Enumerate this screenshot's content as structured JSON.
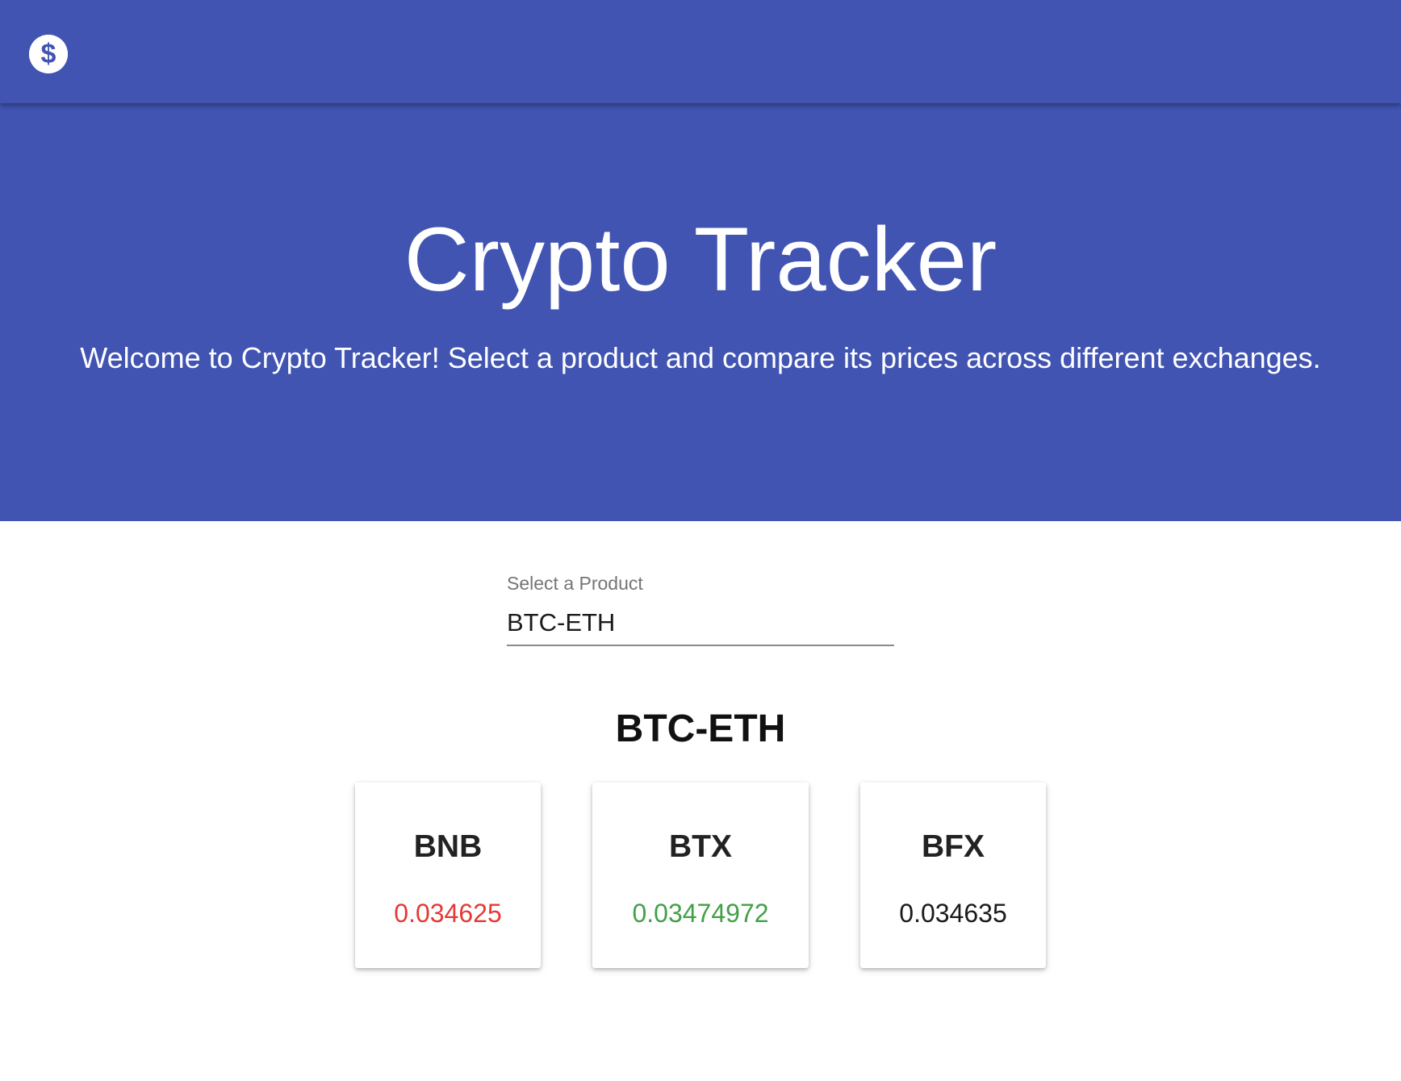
{
  "app": {
    "logo_icon": "dollar-circle-icon"
  },
  "hero": {
    "title": "Crypto Tracker",
    "subtitle": "Welcome to Crypto Tracker! Select a product and compare its prices across different exchanges."
  },
  "product_select": {
    "label": "Select a Product",
    "value": "BTC-ETH"
  },
  "product_heading": "BTC-ETH",
  "exchanges": [
    {
      "name": "BNB",
      "price": "0.034625",
      "price_color": "#e53935",
      "trend": "down"
    },
    {
      "name": "BTX",
      "price": "0.03474972",
      "price_color": "#43a047",
      "trend": "up"
    },
    {
      "name": "BFX",
      "price": "0.034635",
      "price_color": "#1a1a1a",
      "trend": "neutral"
    }
  ],
  "colors": {
    "primary": "#4154b2",
    "price_down": "#e53935",
    "price_up": "#43a047",
    "price_neutral": "#1a1a1a"
  }
}
